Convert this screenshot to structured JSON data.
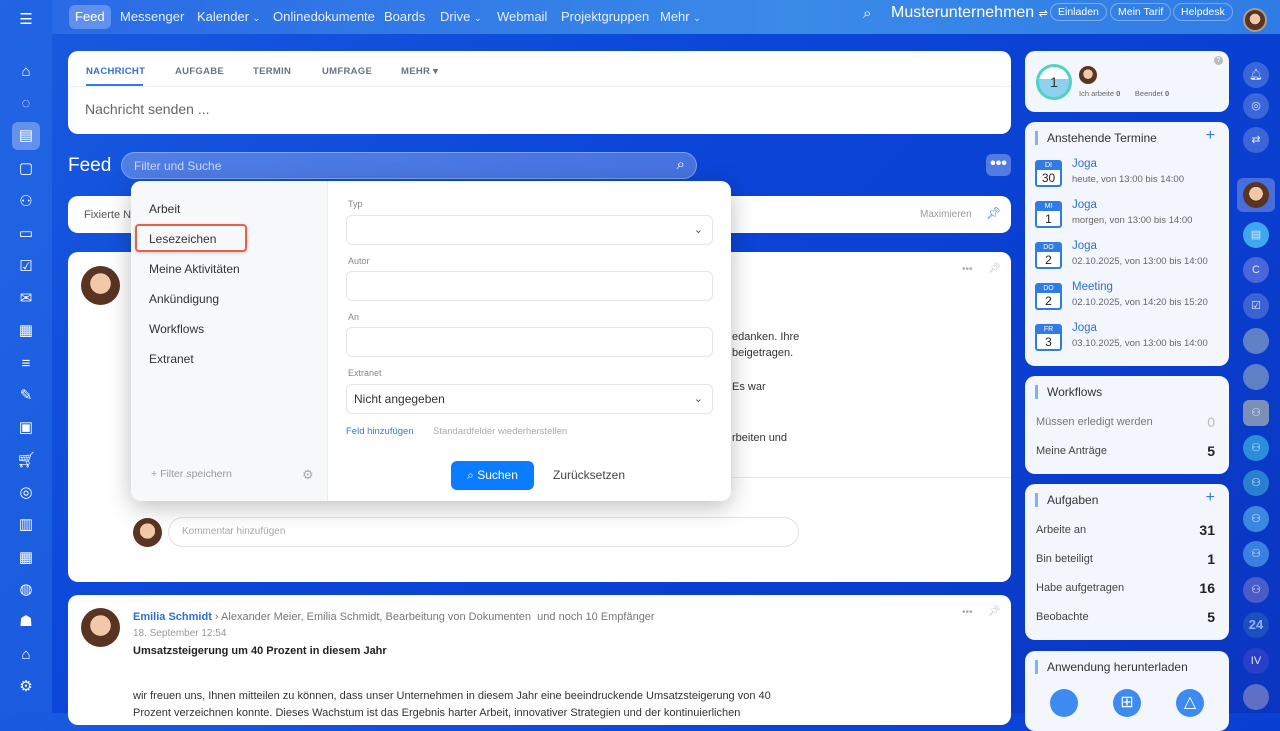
{
  "topnav": {
    "items": [
      "Feed",
      "Messenger",
      "Kalender",
      "Onlinedokumente",
      "Boards",
      "Drive",
      "Webmail",
      "Projektgruppen",
      "Mehr"
    ],
    "company": "Musterunternehmen",
    "buttons": [
      "Einladen",
      "Mein Tarif",
      "Helpdesk"
    ]
  },
  "composer": {
    "tabs": [
      "NACHRICHT",
      "AUFGABE",
      "TERMIN",
      "UMFRAGE",
      "MEHR"
    ],
    "placeholder": "Nachricht senden ..."
  },
  "feed": {
    "title": "Feed",
    "search_placeholder": "Filter und Suche",
    "pinned_label": "Fixierte N",
    "maximize": "Maximieren"
  },
  "filter_popup": {
    "presets": [
      "Arbeit",
      "Lesezeichen",
      "Meine Aktivitäten",
      "Ankündigung",
      "Workflows",
      "Extranet"
    ],
    "highlighted": "Lesezeichen",
    "save_filter": "Filter speichern",
    "fields": {
      "typ_label": "Typ",
      "typ_value": "",
      "autor_label": "Autor",
      "an_label": "An",
      "extranet_label": "Extranet",
      "extranet_value": "Nicht angegeben"
    },
    "add_field": "Feld hinzufügen",
    "restore": "Standardfelder wiederherstellen",
    "search_button": "Suchen",
    "reset_button": "Zurücksetzen"
  },
  "post1": {
    "fragments": [
      "edanken. Ihre",
      "beigetragen.",
      "Es war",
      "rbeiten und"
    ],
    "comment_placeholder": "Kommentar hinzufügen"
  },
  "post2": {
    "author": "Emilia Schmidt",
    "recipients": "Alexander Meier, Emilia Schmidt, Bearbeitung von Dokumenten",
    "more_recipients": "und noch 10 Empfänger",
    "date": "18. September 12:54",
    "title": "Umsatzsteigerung um 40 Prozent in diesem Jahr",
    "body1": "wir freuen uns, Ihnen mitteilen zu können, dass unser Unternehmen in diesem Jahr eine beeindruckende Umsatzsteigerung von 40",
    "body2": "Prozent verzeichnen konnte. Dieses Wachstum ist das Ergebnis harter Arbeit, innovativer Strategien und der kontinuierlichen"
  },
  "worktime": {
    "count": "1",
    "working_label": "Ich arbeite",
    "working": "0",
    "done_label": "Beendet",
    "done": "0"
  },
  "events": {
    "title": "Anstehende Termine",
    "items": [
      {
        "day": "DI",
        "num": "30",
        "title": "Joga",
        "time": "heute, von 13:00 bis 14:00"
      },
      {
        "day": "MI",
        "num": "1",
        "title": "Joga",
        "time": "morgen, von 13:00 bis 14:00"
      },
      {
        "day": "DO",
        "num": "2",
        "title": "Joga",
        "time": "02.10.2025, von 13:00 bis 14:00"
      },
      {
        "day": "DO",
        "num": "2",
        "title": "Meeting",
        "time": "02.10.2025, von 14:20 bis 15:20"
      },
      {
        "day": "FR",
        "num": "3",
        "title": "Joga",
        "time": "03.10.2025, von 13:00 bis 14:00"
      }
    ]
  },
  "workflows": {
    "title": "Workflows",
    "rows": [
      {
        "label": "Müssen erledigt werden",
        "value": "0"
      },
      {
        "label": "Meine Anträge",
        "value": "5"
      }
    ]
  },
  "tasks": {
    "title": "Aufgaben",
    "rows": [
      {
        "label": "Arbeite an",
        "value": "31"
      },
      {
        "label": "Bin beteiligt",
        "value": "1"
      },
      {
        "label": "Habe aufgetragen",
        "value": "16"
      },
      {
        "label": "Beobachte",
        "value": "5"
      }
    ]
  },
  "download": {
    "title": "Anwendung herunterladen"
  },
  "right_rail": {
    "badge_24": "24",
    "badge_iv": "IV",
    "badge_c": "C"
  },
  "colors": {
    "accent": "#2f7ce6",
    "highlight": "#e8604c"
  }
}
